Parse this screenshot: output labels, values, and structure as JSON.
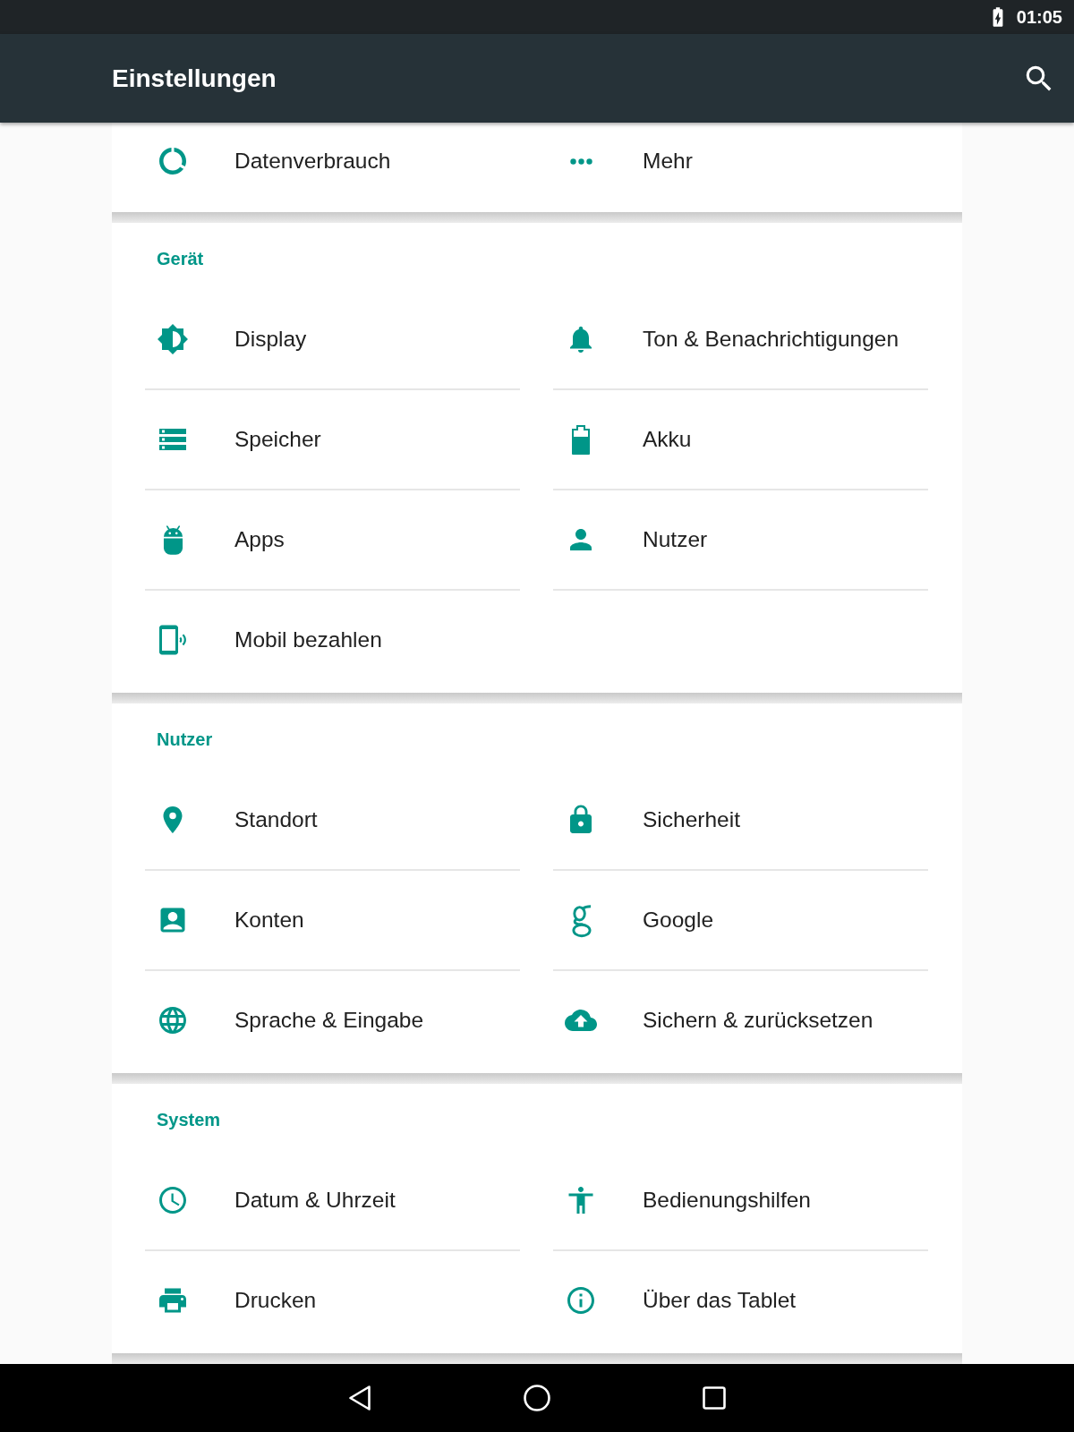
{
  "status_bar": {
    "time": "01:05"
  },
  "toolbar": {
    "title": "Einstellungen"
  },
  "sections": [
    {
      "items": [
        "Datenverbrauch",
        "Mehr"
      ]
    },
    {
      "header": "Gerät",
      "items": [
        "Display",
        "Ton & Benachrichtigungen",
        "Speicher",
        "Akku",
        "Apps",
        "Nutzer",
        "Mobil bezahlen"
      ]
    },
    {
      "header": "Nutzer",
      "items": [
        "Standort",
        "Sicherheit",
        "Konten",
        "Google",
        "Sprache & Eingabe",
        "Sichern & zurücksetzen"
      ]
    },
    {
      "header": "System",
      "items": [
        "Datum & Uhrzeit",
        "Bedienungshilfen",
        "Drucken",
        "Über das Tablet"
      ]
    }
  ]
}
